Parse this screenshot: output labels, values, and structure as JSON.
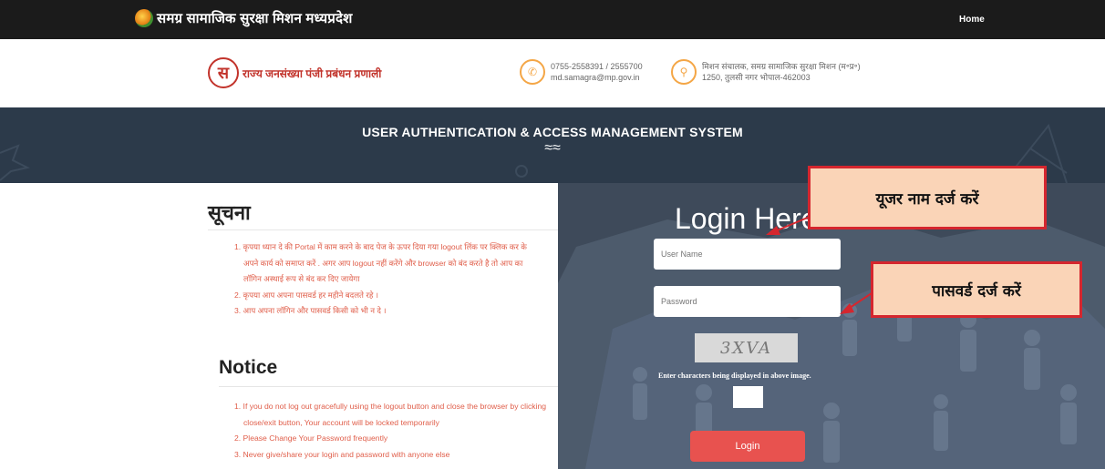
{
  "topbar": {
    "brand_title": "समग्र सामाजिक सुरक्षा मिशन मध्यप्रदेश",
    "nav_home": "Home"
  },
  "header": {
    "logo_letter": "स",
    "logo_name": "राज्य जनसंख्या पंजी प्रबंधन प्रणाली",
    "phone_line1": "0755-2558391 / 2555700",
    "phone_line2": "md.samagra@mp.gov.in",
    "address_line1": "मिशन संचालक, समग्र सामाजिक सुरक्षा मिशन (म॰प्र॰)",
    "address_line2": "1250, तुलसी नगर भोपाल-462003"
  },
  "banner": {
    "title": "USER AUTHENTICATION & ACCESS MANAGEMENT SYSTEM",
    "wave": "≈≈"
  },
  "notice_hindi": {
    "heading": "सूचना",
    "items": [
      "1. कृपया ध्यान दे की Portal में काम करने के बाद पेज के ऊपर दिया गया logout लिंक पर क्लिक कर के",
      "अपने कार्य को समाप्त करें . अगर आप logout नहीं करेंगे और browser को बंद करते है तो आप का",
      "लॉगिन अस्थाई रूप से बंद कर दिए जायेगा",
      "2. कृपया आप अपना पासवर्ड हर महीने बदलते रहे ।",
      "3. आप अपना लॉगिन और पासवर्ड किसी को भी न दे ।"
    ]
  },
  "notice_english": {
    "heading": "Notice",
    "items": [
      "1. If you do not log out gracefully using the logout button and close the browser by clicking",
      "close/exit button, Your account will be locked temporarily",
      "2. Please Change Your Password frequently",
      "3. Never give/share your login and password with anyone else"
    ]
  },
  "login": {
    "title": "Login Here",
    "username_placeholder": "User Name",
    "password_placeholder": "Password",
    "captcha_text": "3XVA",
    "captcha_instruction": "Enter characters being displayed in above image.",
    "button_label": "Login"
  },
  "annotations": {
    "username_callout": "यूजर नाम दर्ज करें",
    "password_callout": "पासवर्ड दर्ज करें"
  },
  "colors": {
    "topbar": "#1b1b1b",
    "banner": "#2c3a4a",
    "notice_text": "#e05e4a",
    "login_button": "#e8524f",
    "callout_fill": "#fad4b7",
    "callout_border": "#d5262e"
  },
  "icons": {
    "brand": "samagra-logo-icon",
    "phone": "phone-icon",
    "location": "location-pin-icon"
  }
}
